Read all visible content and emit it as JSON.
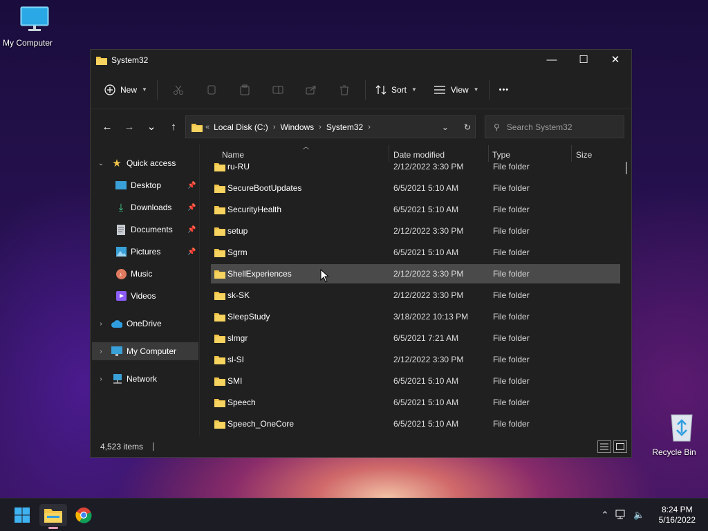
{
  "desktop": {
    "icons": [
      {
        "label": "My Computer"
      },
      {
        "label": "Recycle Bin"
      }
    ]
  },
  "window": {
    "title": "System32",
    "controls": {
      "minimize": "—",
      "maximize": "☐",
      "close": "✕"
    }
  },
  "command_bar": {
    "new_label": "New",
    "sort_label": "Sort",
    "view_label": "View",
    "more_label": "•••",
    "icon_buttons": [
      "cut-icon",
      "copy-icon",
      "paste-icon",
      "rename-icon",
      "share-icon",
      "delete-icon"
    ]
  },
  "navigation": {
    "back": "←",
    "forward": "→",
    "recent": "⌄",
    "up": "↑",
    "address": {
      "overflow": "«",
      "crumbs": [
        "Local Disk (C:)",
        "Windows",
        "System32"
      ],
      "sep": "›"
    },
    "search_placeholder": "Search System32"
  },
  "sidebar": {
    "quick_access": "Quick access",
    "items": [
      {
        "label": "Desktop",
        "icon": "desktop-icon",
        "pinned": true
      },
      {
        "label": "Downloads",
        "icon": "downloads-icon",
        "pinned": true
      },
      {
        "label": "Documents",
        "icon": "documents-icon",
        "pinned": true
      },
      {
        "label": "Pictures",
        "icon": "pictures-icon",
        "pinned": true
      },
      {
        "label": "Music",
        "icon": "music-icon",
        "pinned": false
      },
      {
        "label": "Videos",
        "icon": "videos-icon",
        "pinned": false
      }
    ],
    "onedrive": "OneDrive",
    "my_computer": "My Computer",
    "network": "Network"
  },
  "columns": {
    "name": "Name",
    "date": "Date modified",
    "type": "Type",
    "size": "Size"
  },
  "files": [
    {
      "name": "ru-RU",
      "date": "2/12/2022 3:30 PM",
      "type": "File folder"
    },
    {
      "name": "SecureBootUpdates",
      "date": "6/5/2021 5:10 AM",
      "type": "File folder"
    },
    {
      "name": "SecurityHealth",
      "date": "6/5/2021 5:10 AM",
      "type": "File folder"
    },
    {
      "name": "setup",
      "date": "2/12/2022 3:30 PM",
      "type": "File folder"
    },
    {
      "name": "Sgrm",
      "date": "6/5/2021 5:10 AM",
      "type": "File folder"
    },
    {
      "name": "ShellExperiences",
      "date": "2/12/2022 3:30 PM",
      "type": "File folder"
    },
    {
      "name": "sk-SK",
      "date": "2/12/2022 3:30 PM",
      "type": "File folder"
    },
    {
      "name": "SleepStudy",
      "date": "3/18/2022 10:13 PM",
      "type": "File folder"
    },
    {
      "name": "slmgr",
      "date": "6/5/2021 7:21 AM",
      "type": "File folder"
    },
    {
      "name": "sl-SI",
      "date": "2/12/2022 3:30 PM",
      "type": "File folder"
    },
    {
      "name": "SMI",
      "date": "6/5/2021 5:10 AM",
      "type": "File folder"
    },
    {
      "name": "Speech",
      "date": "6/5/2021 5:10 AM",
      "type": "File folder"
    },
    {
      "name": "Speech_OneCore",
      "date": "6/5/2021 5:10 AM",
      "type": "File folder"
    }
  ],
  "selected_file": "ShellExperiences",
  "status": {
    "item_count": "4,523 items"
  },
  "taskbar": {
    "apps": [
      "start-icon",
      "file-explorer-icon",
      "chrome-icon"
    ],
    "tray": {
      "chevron": "⌃",
      "time": "8:24 PM",
      "date": "5/16/2022"
    }
  },
  "colors": {
    "window_bg": "#202020",
    "selected_row": "#4a4a4a",
    "folder_yellow": "#f3c64a",
    "accent_blue": "#4aa3ff"
  }
}
